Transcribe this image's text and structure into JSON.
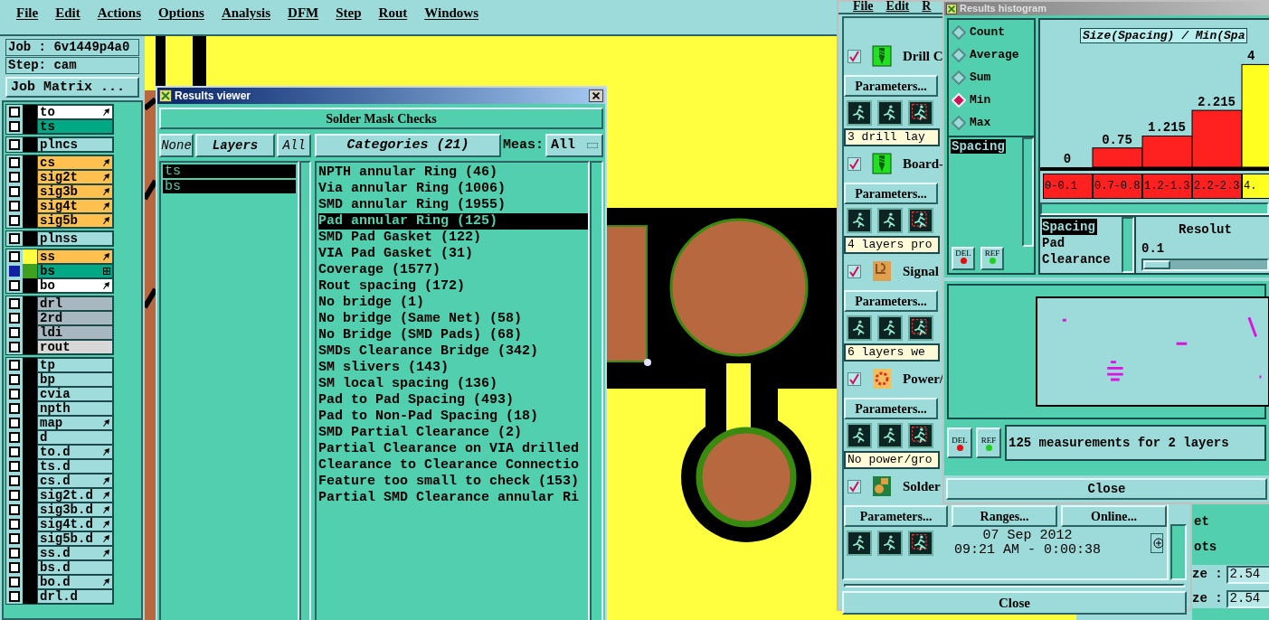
{
  "main_menu": [
    "File",
    "Edit",
    "Actions",
    "Options",
    "Analysis",
    "DFM",
    "Step",
    "Rout",
    "Windows"
  ],
  "job": "Job : 6v1449p4a0",
  "step": "Step: cam",
  "job_matrix_button": "Job Matrix ...",
  "layer_groups": [
    {
      "layers": [
        {
          "name": "to",
          "color": "#ffffff",
          "kind": "pointer",
          "selected": false
        },
        {
          "name": "ts",
          "color": "#00a884",
          "kind": "plain",
          "selected": false
        }
      ]
    },
    {
      "layers": [
        {
          "name": "plncs",
          "color": "#a0dcdc",
          "kind": "plain",
          "selected": false
        }
      ]
    },
    {
      "layers": [
        {
          "name": "cs",
          "color": "#ffc050",
          "kind": "pointer",
          "selected": false
        },
        {
          "name": "sig2t",
          "color": "#ffc050",
          "kind": "pointer",
          "selected": false
        },
        {
          "name": "sig3b",
          "color": "#ffc050",
          "kind": "pointer",
          "selected": false
        },
        {
          "name": "sig4t",
          "color": "#ffc050",
          "kind": "pointer",
          "selected": false
        },
        {
          "name": "sig5b",
          "color": "#ffc050",
          "kind": "pointer",
          "selected": false
        }
      ]
    },
    {
      "layers": [
        {
          "name": "plnss",
          "color": "#a0dcdc",
          "kind": "plain",
          "selected": false
        }
      ]
    },
    {
      "layers": [
        {
          "name": "ss",
          "color": "#ffc050",
          "kind": "pointer",
          "swatch": {
            "color": "#ffff40"
          },
          "selected": false
        },
        {
          "name": "bs",
          "color": "#00a884",
          "kind": "grid",
          "swatch": {
            "color": "#40a020"
          },
          "selected": true
        },
        {
          "name": "bo",
          "color": "#ffffff",
          "kind": "pointer",
          "selected": false
        }
      ]
    },
    {
      "layers": [
        {
          "name": "drl",
          "color": "#a8b8c0",
          "kind": "plain",
          "selected": false
        },
        {
          "name": "2rd",
          "color": "#a8b8c0",
          "kind": "plain",
          "selected": false
        },
        {
          "name": "ldi",
          "color": "#a8b8c0",
          "kind": "plain",
          "selected": false
        },
        {
          "name": "rout",
          "color": "#d8d8d8",
          "kind": "plain",
          "selected": false
        }
      ]
    },
    {
      "layers": [
        {
          "name": "tp",
          "color": "#a0dcdc",
          "kind": "plain",
          "selected": false
        },
        {
          "name": "bp",
          "color": "#a0dcdc",
          "kind": "plain",
          "selected": false
        },
        {
          "name": "cvia",
          "color": "#a0dcdc",
          "kind": "plain",
          "selected": false
        },
        {
          "name": "npth",
          "color": "#a0dcdc",
          "kind": "plain",
          "selected": false
        },
        {
          "name": "map",
          "color": "#a0dcdc",
          "kind": "pointer",
          "selected": false
        },
        {
          "name": "d",
          "color": "#a0dcdc",
          "kind": "plain",
          "selected": false
        },
        {
          "name": "to.d",
          "color": "#a0dcdc",
          "kind": "pointer",
          "selected": false
        },
        {
          "name": "ts.d",
          "color": "#a0dcdc",
          "kind": "plain",
          "selected": false
        },
        {
          "name": "cs.d",
          "color": "#a0dcdc",
          "kind": "pointer",
          "selected": false
        },
        {
          "name": "sig2t.d",
          "color": "#a0dcdc",
          "kind": "pointer",
          "selected": false
        },
        {
          "name": "sig3b.d",
          "color": "#a0dcdc",
          "kind": "pointer",
          "selected": false
        },
        {
          "name": "sig4t.d",
          "color": "#a0dcdc",
          "kind": "pointer",
          "selected": false
        },
        {
          "name": "sig5b.d",
          "color": "#a0dcdc",
          "kind": "pointer",
          "selected": false
        },
        {
          "name": "ss.d",
          "color": "#a0dcdc",
          "kind": "pointer",
          "selected": false
        },
        {
          "name": "bs.d",
          "color": "#a0dcdc",
          "kind": "plain",
          "selected": false
        },
        {
          "name": "bo.d",
          "color": "#a0dcdc",
          "kind": "pointer",
          "selected": false
        },
        {
          "name": "drl.d",
          "color": "#a0dcdc",
          "kind": "plain",
          "selected": false
        }
      ]
    }
  ],
  "results_viewer": {
    "title": "Results viewer",
    "header_button": "Solder Mask Checks",
    "layer_buttons": [
      "None",
      "Layers",
      "All"
    ],
    "layers": [
      {
        "name": "ts",
        "selected": true
      },
      {
        "name": "bs",
        "selected": true
      }
    ],
    "categories_button": "Categories (21)",
    "meas_label": "Meas:",
    "meas_value": "All",
    "categories": [
      {
        "label": "NPTH annular Ring (46)",
        "selected": false
      },
      {
        "label": "Via annular Ring (1006)",
        "selected": false
      },
      {
        "label": "SMD annular Ring (1955)",
        "selected": false
      },
      {
        "label": "Pad annular Ring (125)",
        "selected": true
      },
      {
        "label": "SMD Pad Gasket (122)",
        "selected": false
      },
      {
        "label": "VIA Pad Gasket (31)",
        "selected": false
      },
      {
        "label": "Coverage (1577)",
        "selected": false
      },
      {
        "label": "Rout spacing (172)",
        "selected": false
      },
      {
        "label": "No bridge (1)",
        "selected": false
      },
      {
        "label": "No bridge (Same Net) (58)",
        "selected": false
      },
      {
        "label": "No Bridge (SMD Pads) (68)",
        "selected": false
      },
      {
        "label": "SMDs Clearance Bridge (342)",
        "selected": false
      },
      {
        "label": "SM slivers (143)",
        "selected": false
      },
      {
        "label": "SM local spacing (136)",
        "selected": false
      },
      {
        "label": "Pad to Pad Spacing (493)",
        "selected": false
      },
      {
        "label": "Pad to Non-Pad Spacing (18)",
        "selected": false
      },
      {
        "label": "SMD Partial Clearance (2)",
        "selected": false
      },
      {
        "label": "Partial Clearance on VIA drilled",
        "selected": false
      },
      {
        "label": "Clearance to Clearance Connectio",
        "selected": false
      },
      {
        "label": "Feature too small to check (153)",
        "selected": false
      },
      {
        "label": "Partial SMD Clearance annular Ri",
        "selected": false
      }
    ]
  },
  "checklist_window": {
    "menu": [
      "File",
      "Edit",
      "R"
    ],
    "items": [
      {
        "kind": "drill",
        "title": "Drill C",
        "checked": true,
        "buttons": [
          "Parameters..."
        ],
        "status": "3 drill lay"
      },
      {
        "kind": "drill",
        "title": "Board-",
        "checked": true,
        "buttons": [
          "Parameters..."
        ],
        "status": "4 layers pro"
      },
      {
        "kind": "signal",
        "title": "Signal",
        "checked": true,
        "buttons": [
          "Parameters..."
        ],
        "status": "6 layers we"
      },
      {
        "kind": "power",
        "title": "Power/",
        "checked": true,
        "buttons": [
          "Parameters..."
        ],
        "status": "No power/gro"
      },
      {
        "kind": "solder",
        "title": "Solder",
        "checked": true,
        "buttons": [
          "Parameters...",
          "Ranges...",
          "Online..."
        ]
      }
    ],
    "date": "07 Sep 2012",
    "time": "09:21 AM - 0:00:38",
    "close": "Close"
  },
  "histogram": {
    "title": "Results histogram",
    "modes": [
      {
        "label": "Count",
        "selected": false
      },
      {
        "label": "Average",
        "selected": false
      },
      {
        "label": "Sum",
        "selected": false
      },
      {
        "label": "Min",
        "selected": true
      },
      {
        "label": "Max",
        "selected": false
      }
    ],
    "measures": [
      {
        "label": "Spacing",
        "selected": true
      }
    ],
    "list_buttons": [
      "DEL",
      "REF"
    ],
    "chart_data": {
      "type": "bar",
      "title": "Size(Spacing) / Min(Spa",
      "categories": [
        "0-0.1",
        "0.7-0.8",
        "1.2-1.3",
        "2.2-2.3",
        "4."
      ],
      "series": [
        {
          "color": "#ff2020",
          "values": [
            0,
            0.75,
            1.215,
            2.215,
            null
          ]
        },
        {
          "color": "#ffff20",
          "values": [
            null,
            null,
            null,
            null,
            4
          ]
        }
      ],
      "data_labels": true
    },
    "attributes": [
      {
        "label": "Spacing",
        "selected": true
      },
      {
        "label": "Pad",
        "selected": false
      },
      {
        "label": "Clearance",
        "selected": false
      }
    ],
    "resolution_label": "Resolut",
    "resolution_value": "0.1",
    "resolution_slider": {
      "level": 0
    },
    "preview_buttons": [
      "DEL",
      "REF"
    ],
    "status": "125 measurements for 2 layers",
    "close": "Close"
  },
  "side_panel": {
    "labels": [
      "et",
      "ots"
    ],
    "fields": [
      {
        "label": "ze :",
        "value": "2.54"
      },
      {
        "label": "ze :",
        "value": "2.54"
      }
    ]
  }
}
